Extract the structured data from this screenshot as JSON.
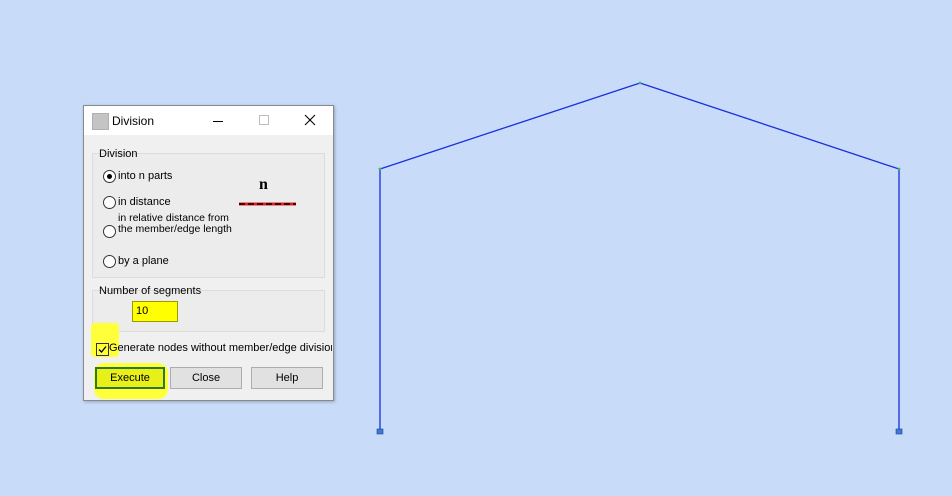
{
  "dialog": {
    "title": "Division",
    "division_group": {
      "label": "Division",
      "options": [
        {
          "label": "into n parts",
          "checked": true
        },
        {
          "label": "in distance",
          "checked": false
        },
        {
          "label": "in relative distance from the member/edge length",
          "checked": false
        },
        {
          "label": "by a plane",
          "checked": false
        }
      ],
      "illustration_label": "n"
    },
    "segments_group": {
      "label": "Number of segments",
      "value": "10"
    },
    "generate_nodes": {
      "label": "Generate nodes without member/edge division",
      "checked": true
    },
    "buttons": {
      "execute": "Execute",
      "close": "Close",
      "help": "Help"
    }
  },
  "colors": {
    "background": "#c8dcfa",
    "frame_line": "#1a2ee0",
    "highlight": "#ffff00"
  },
  "icons": [
    "minimize-icon",
    "maximize-icon",
    "close-icon",
    "radio-icon",
    "checkmark-icon",
    "support-icon"
  ]
}
